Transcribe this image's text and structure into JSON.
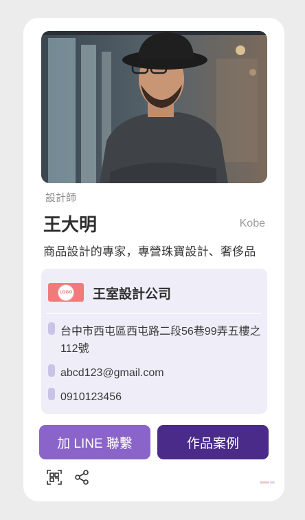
{
  "profile": {
    "role": "設計師",
    "name": "王大明",
    "nickname": "Kobe",
    "bio": "商品設計的專家，專營珠寶設計、奢侈品"
  },
  "company": {
    "logo_text": "LOGO",
    "name": "王室設計公司",
    "address": "台中市西屯區西屯路二段56巷99弄五樓之112號",
    "email": "abcd123@gmail.com",
    "phone": "0910123456"
  },
  "actions": {
    "line_label": "加 LINE 聯繫",
    "works_label": "作品案例"
  },
  "icons": {
    "qr": "qr-code-icon",
    "share": "share-icon"
  },
  "colors": {
    "primary_light": "#8a64c9",
    "primary_dark": "#4a2b8a",
    "panel": "#efedf8",
    "logo": "#f17a7a"
  }
}
